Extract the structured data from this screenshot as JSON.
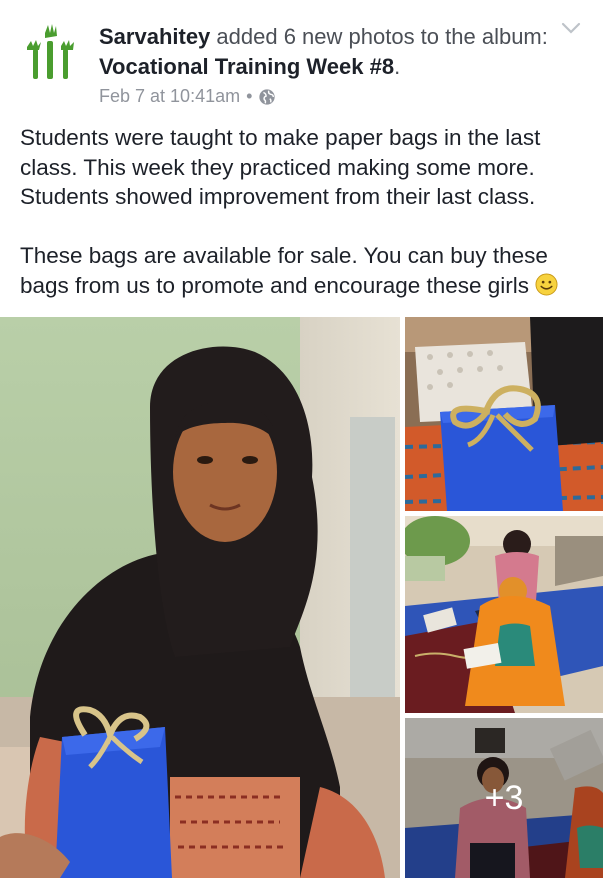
{
  "post": {
    "author": "Sarvahitey",
    "action": " added 6 new photos to the album: ",
    "album": "Vocational Training Week #8",
    "period": ".",
    "timestamp": "Feb 7 at 10:41am",
    "separator": "•",
    "privacy_icon": "globe-icon",
    "menu_icon": "chevron-down-icon",
    "paragraphs": [
      "Students were taught to make paper bags in the last class. This week they practiced making some more. Students showed improvement from their last class.",
      "These bags are available for sale. You can buy these bags from us to promote and encourage these girls"
    ],
    "emoji": "smile-emoji"
  },
  "photos": {
    "more_count": "+3"
  },
  "colors": {
    "logo_green": "#4a9d2f",
    "text_primary": "#1d2129",
    "text_secondary": "#90949c",
    "bag_blue": "#2a56d8"
  }
}
